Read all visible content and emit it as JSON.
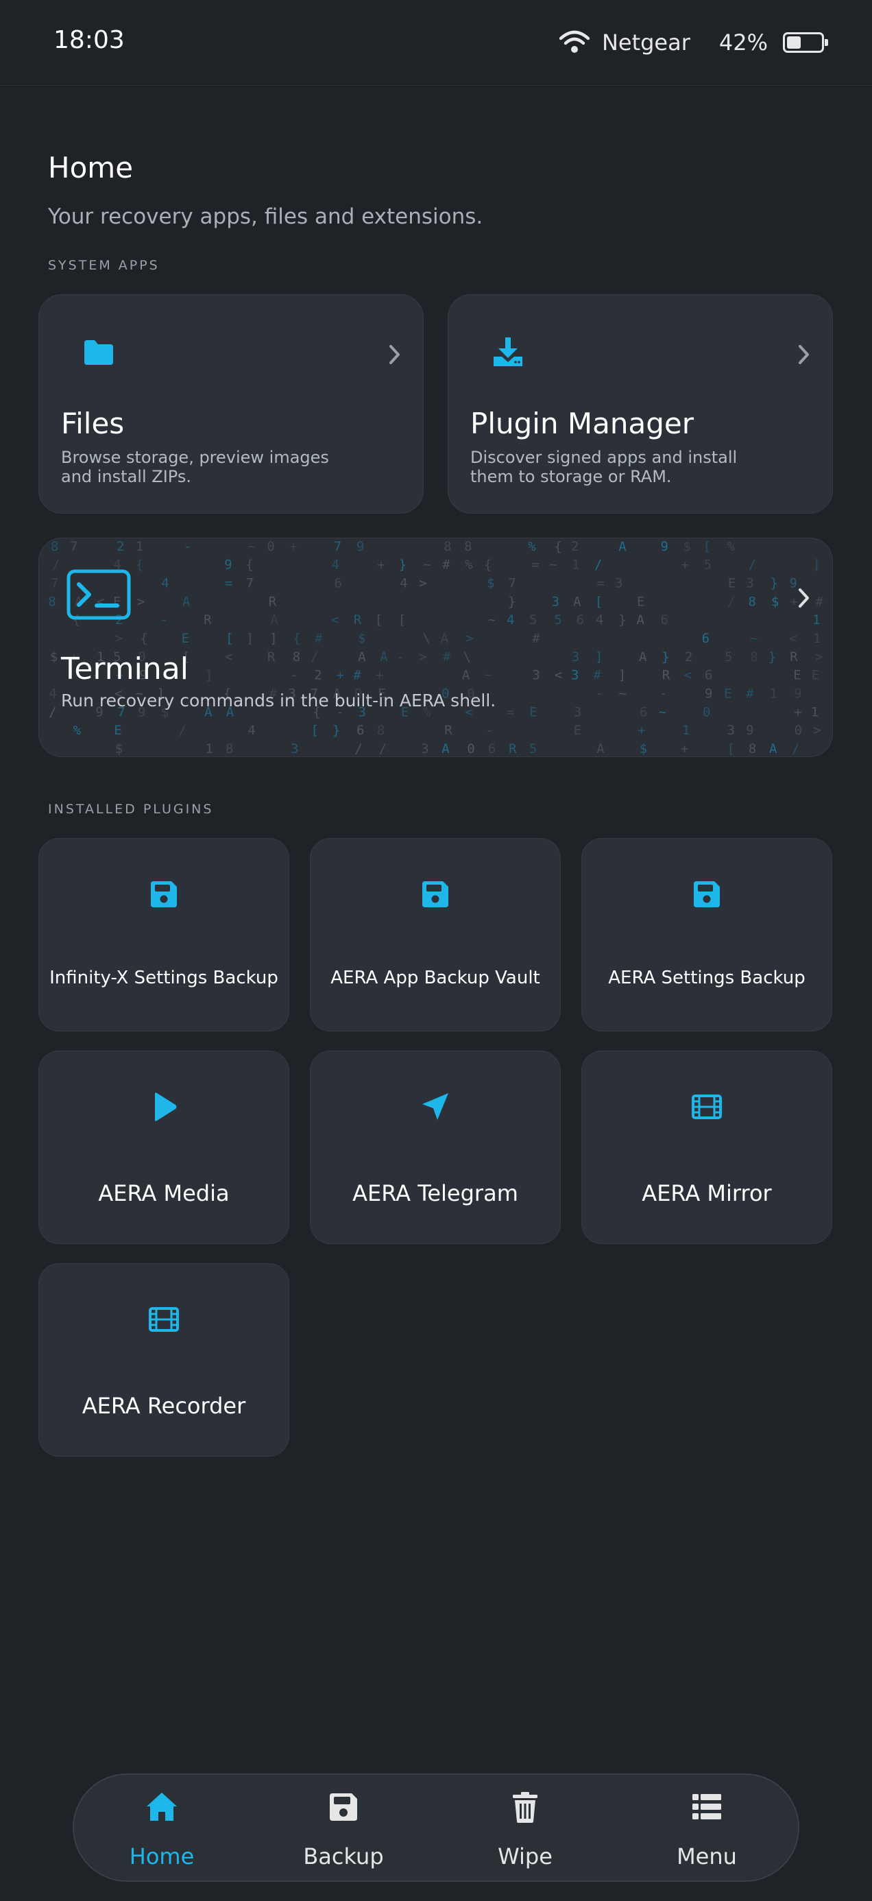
{
  "status_bar": {
    "time": "18:03",
    "network": "Netgear",
    "battery": "42%",
    "battery_level": 0.42
  },
  "header": {
    "title": "Home",
    "subtitle": "Your recovery apps, files and extensions."
  },
  "sections": {
    "system_apps": "SYSTEM APPS",
    "installed_plugins": "INSTALLED PLUGINS"
  },
  "system_apps": [
    {
      "title": "Files",
      "desc_line1": "Browse storage, preview images",
      "desc_line2": "and install ZIPs.",
      "icon": "folder-icon"
    },
    {
      "title": "Plugin Manager",
      "desc_line1": "Discover signed apps and install",
      "desc_line2": "them to storage or RAM.",
      "icon": "download-icon"
    }
  ],
  "terminal": {
    "title": "Terminal",
    "desc": "Run recovery commands in the built-in AERA shell.",
    "icon": "terminal-icon"
  },
  "plugins": [
    {
      "label": "Infinity-X Settings Backup",
      "icon": "floppy-icon"
    },
    {
      "label": "AERA App Backup Vault",
      "icon": "floppy-icon"
    },
    {
      "label": "AERA Settings Backup",
      "icon": "floppy-icon"
    },
    {
      "label": "AERA Media",
      "icon": "play-icon"
    },
    {
      "label": "AERA Telegram",
      "icon": "telegram-icon"
    },
    {
      "label": "AERA Mirror",
      "icon": "film-icon"
    },
    {
      "label": "AERA Recorder",
      "icon": "film-icon"
    }
  ],
  "nav": [
    {
      "label": "Home",
      "icon": "home-icon",
      "active": true
    },
    {
      "label": "Backup",
      "icon": "floppy-icon",
      "active": false
    },
    {
      "label": "Wipe",
      "icon": "trash-icon",
      "active": false
    },
    {
      "label": "Menu",
      "icon": "list-icon",
      "active": false
    }
  ],
  "colors": {
    "accent": "#1fb7ea",
    "background": "#1f2227",
    "card": "#2c3038"
  }
}
